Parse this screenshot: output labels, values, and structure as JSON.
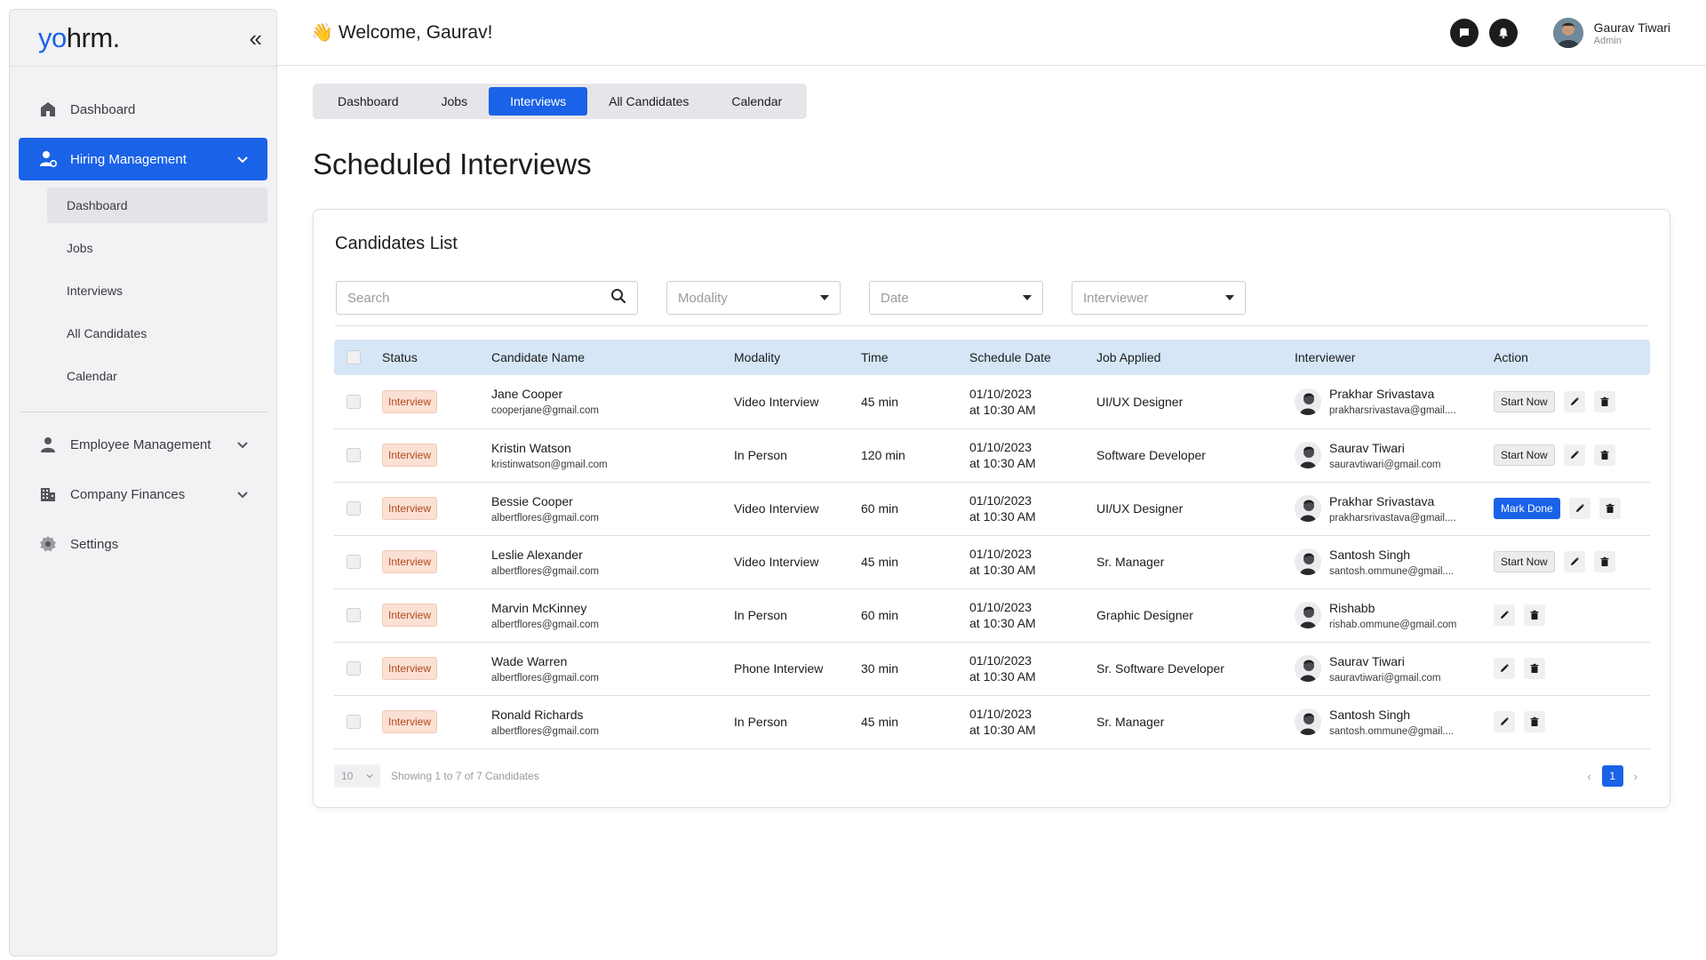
{
  "brand": {
    "logo_prefix": "yo",
    "logo_suffix": "hrm.",
    "accent": "#1a62e8"
  },
  "sidebar": {
    "items": [
      {
        "label": "Dashboard"
      },
      {
        "label": "Hiring Management"
      },
      {
        "label": "Employee Management"
      },
      {
        "label": "Company Finances"
      },
      {
        "label": "Settings"
      }
    ],
    "sub_items": [
      {
        "label": "Dashboard"
      },
      {
        "label": "Jobs"
      },
      {
        "label": "Interviews"
      },
      {
        "label": "All Candidates"
      },
      {
        "label": "Calendar"
      }
    ]
  },
  "header": {
    "welcome": "Welcome,  Gaurav!",
    "wave": "👋"
  },
  "user": {
    "name": "Gaurav Tiwari",
    "role": "Admin"
  },
  "tabs": [
    {
      "label": "Dashboard"
    },
    {
      "label": "Jobs"
    },
    {
      "label": "Interviews"
    },
    {
      "label": "All Candidates"
    },
    {
      "label": "Calendar"
    }
  ],
  "page_title": "Scheduled Interviews",
  "card": {
    "title": "Candidates List",
    "filters": {
      "search_placeholder": "Search",
      "modality": "Modality",
      "date": "Date",
      "interviewer": "Interviewer"
    },
    "columns": [
      "Status",
      "Candidate Name",
      "Modality",
      "Time",
      "Schedule Date",
      "Job Applied",
      "Interviewer",
      "Action"
    ],
    "rows": [
      {
        "status": "Interview",
        "name": "Jane Cooper",
        "email": "cooperjane@gmail.com",
        "modality": "Video Interview",
        "time": "45 min",
        "date": "01/10/2023",
        "at": "at 10:30 AM",
        "job": "UI/UX Designer",
        "interviewer": "Prakhar Srivastava",
        "interviewer_email": "prakharsrivastava@gmail....",
        "action": "Start Now",
        "action_style": "start"
      },
      {
        "status": "Interview",
        "name": "Kristin Watson",
        "email": "kristinwatson@gmail.com",
        "modality": "In Person",
        "time": "120 min",
        "date": "01/10/2023",
        "at": "at 10:30 AM",
        "job": "Software Developer",
        "interviewer": "Saurav Tiwari",
        "interviewer_email": "sauravtiwari@gmail.com",
        "action": "Start Now",
        "action_style": "start"
      },
      {
        "status": "Interview",
        "name": "Bessie Cooper",
        "email": "albertflores@gmail.com",
        "modality": "Video Interview",
        "time": "60 min",
        "date": "01/10/2023",
        "at": "at 10:30 AM",
        "job": "UI/UX Designer",
        "interviewer": "Prakhar Srivastava",
        "interviewer_email": "prakharsrivastava@gmail....",
        "action": "Mark Done",
        "action_style": "done"
      },
      {
        "status": "Interview",
        "name": "Leslie Alexander",
        "email": "albertflores@gmail.com",
        "modality": "Video Interview",
        "time": "45 min",
        "date": "01/10/2023",
        "at": "at 10:30 AM",
        "job": "Sr. Manager",
        "interviewer": "Santosh Singh",
        "interviewer_email": "santosh.ommune@gmail....",
        "action": "Start Now",
        "action_style": "start"
      },
      {
        "status": "Interview",
        "name": "Marvin McKinney",
        "email": "albertflores@gmail.com",
        "modality": "In Person",
        "time": "60 min",
        "date": "01/10/2023",
        "at": "at 10:30 AM",
        "job": "Graphic Designer",
        "interviewer": "Rishabb",
        "interviewer_email": "rishab.ommune@gmail.com",
        "action": "",
        "action_style": "none"
      },
      {
        "status": "Interview",
        "name": "Wade Warren",
        "email": "albertflores@gmail.com",
        "modality": "Phone Interview",
        "time": "30 min",
        "date": "01/10/2023",
        "at": "at 10:30 AM",
        "job": "Sr. Software Developer",
        "interviewer": "Saurav Tiwari",
        "interviewer_email": "sauravtiwari@gmail.com",
        "action": "",
        "action_style": "none"
      },
      {
        "status": "Interview",
        "name": "Ronald Richards",
        "email": "albertflores@gmail.com",
        "modality": "In Person",
        "time": "45 min",
        "date": "01/10/2023",
        "at": "at 10:30 AM",
        "job": "Sr. Manager",
        "interviewer": "Santosh Singh",
        "interviewer_email": "santosh.ommune@gmail....",
        "action": "",
        "action_style": "none"
      }
    ],
    "footer": {
      "per_page": "10",
      "showing": "Showing 1 to 7 of 7 Candidates",
      "page": "1"
    }
  }
}
